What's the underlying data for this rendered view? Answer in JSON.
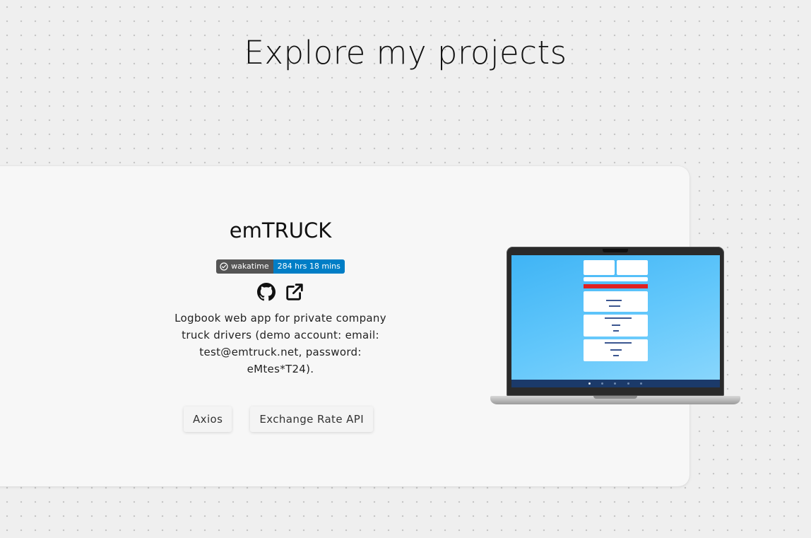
{
  "page": {
    "title": "Explore my projects"
  },
  "project": {
    "name": "emTRUCK",
    "badge": {
      "label": "wakatime",
      "value": "284 hrs 18 mins"
    },
    "links": {
      "github_icon": "github-icon",
      "external_icon": "external-link-icon"
    },
    "description": "Logbook web app for private company truck drivers (demo account: email: test@emtruck.net, password: eMtes*T24).",
    "tech": [
      "Axios",
      "Exchange Rate API"
    ]
  },
  "colors": {
    "background": "#efefef",
    "card": "#f7f7f7",
    "badge_left": "#555555",
    "badge_right": "#007ec6",
    "screen": "#4fbdf7"
  }
}
